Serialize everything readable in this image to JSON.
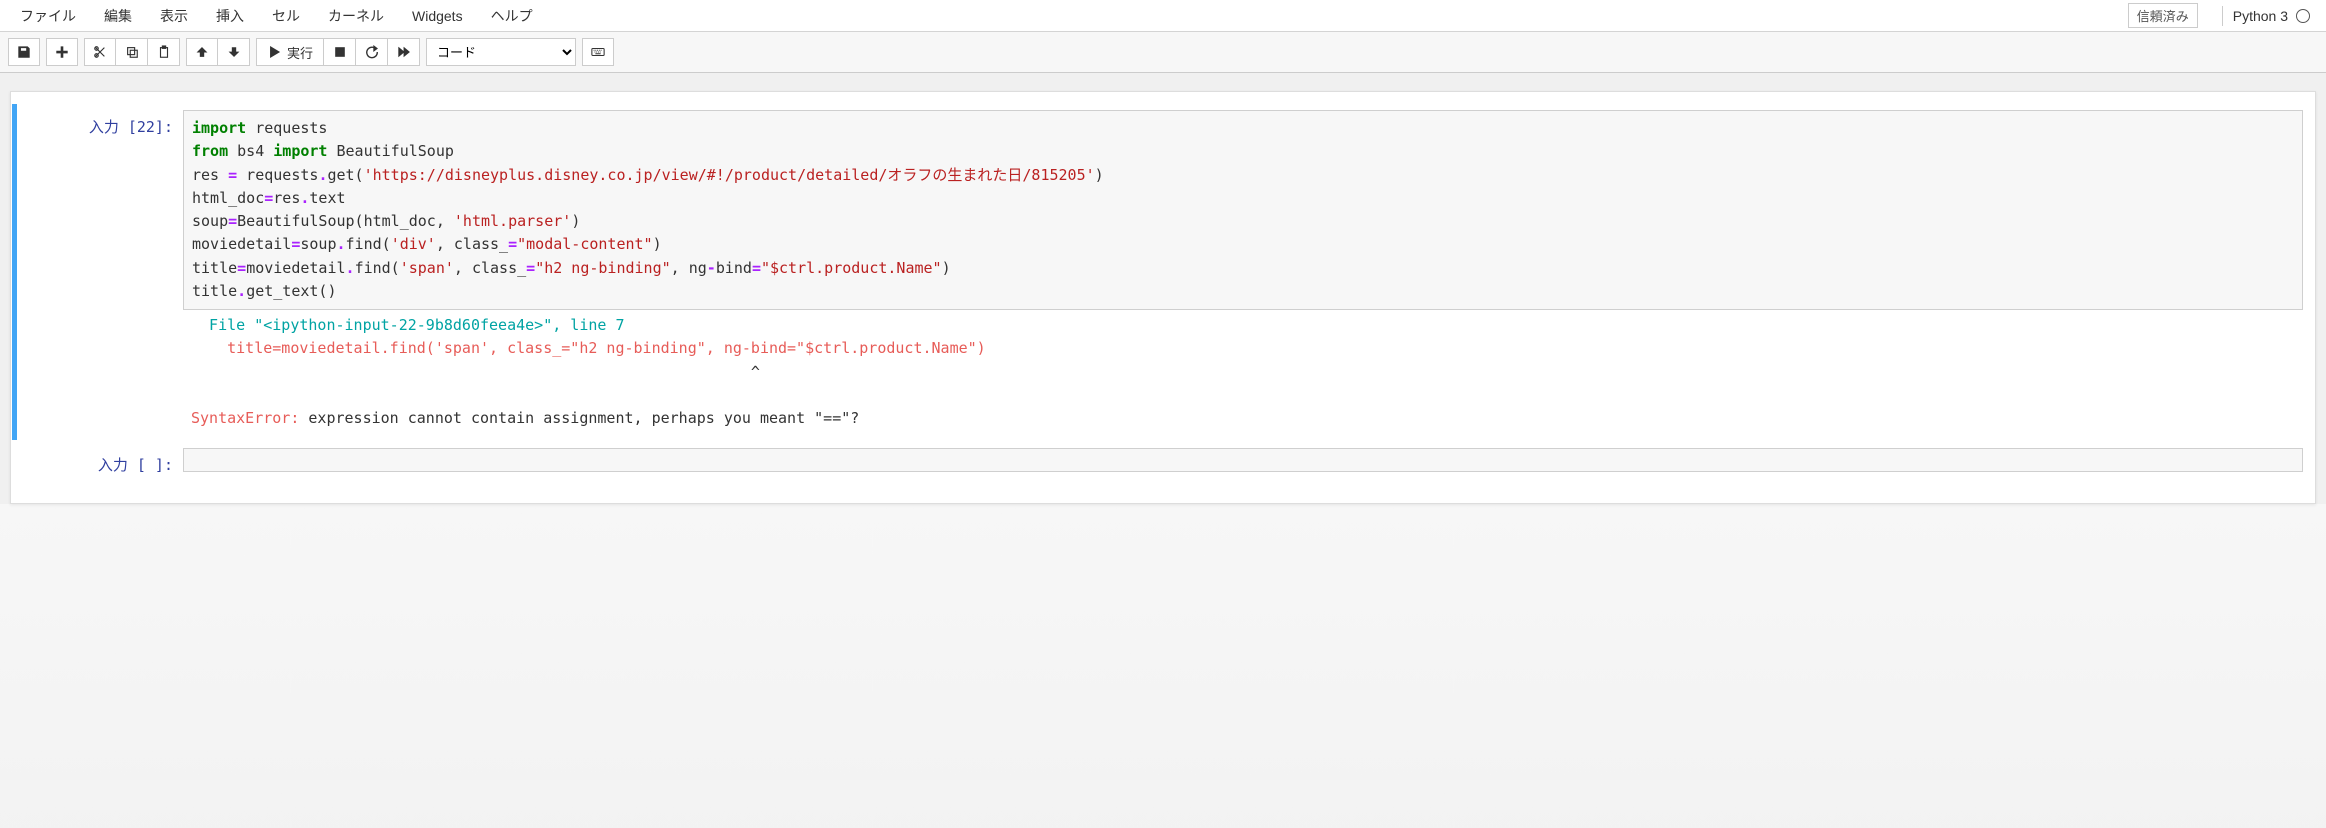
{
  "menubar": {
    "file": "ファイル",
    "edit": "編集",
    "view": "表示",
    "insert": "挿入",
    "cell": "セル",
    "kernel": "カーネル",
    "widgets": "Widgets",
    "help": "ヘルプ"
  },
  "header": {
    "trusted": "信頼済み",
    "kernel_name": "Python 3"
  },
  "toolbar": {
    "run_label": "実行",
    "celltype_selected": "コード"
  },
  "cells": {
    "c0": {
      "prompt_prefix": "入力 ",
      "prompt_num": "[22]:",
      "code": {
        "l1a": "import",
        "l1b": " requests",
        "l2a": "from",
        "l2b": " bs4 ",
        "l2c": "import",
        "l2d": " BeautifulSoup",
        "l3a": "res ",
        "l3b": "=",
        "l3c": " requests",
        "l3d": ".",
        "l3e": "get(",
        "l3f": "'https://disneyplus.disney.co.jp/view/#!/product/detailed/オラフの生まれた日/815205'",
        "l3g": ")",
        "l4a": "html_doc",
        "l4b": "=",
        "l4c": "res",
        "l4d": ".",
        "l4e": "text",
        "l5a": "soup",
        "l5b": "=",
        "l5c": "BeautifulSoup(html_doc, ",
        "l5d": "'html.parser'",
        "l5e": ")",
        "l6a": "moviedetail",
        "l6b": "=",
        "l6c": "soup",
        "l6d": ".",
        "l6e": "find(",
        "l6f": "'div'",
        "l6g": ", class_",
        "l6h": "=",
        "l6i": "\"modal-content\"",
        "l6j": ")",
        "l7a": "title",
        "l7b": "=",
        "l7c": "moviedetail",
        "l7d": ".",
        "l7e": "find(",
        "l7f": "'span'",
        "l7g": ", class_",
        "l7h": "=",
        "l7i": "\"h2 ng-binding\"",
        "l7j": ", ng",
        "l7k": "-",
        "l7l": "bind",
        "l7m": "=",
        "l7n": "\"$ctrl.product.Name\"",
        "l7o": ")",
        "l8a": "title",
        "l8b": ".",
        "l8c": "get_text()"
      },
      "traceback": {
        "l1a": "  File ",
        "l1b": "\"<ipython-input-22-9b8d60feea4e>\"",
        "l1c": ", line ",
        "l1d": "7",
        "l2": "    title=moviedetail.find('span', class_=\"h2 ng-binding\", ng-bind=\"$ctrl.product.Name\")",
        "l3": "                                                              ^",
        "l4a": "SyntaxError",
        "l4b": ": ",
        "l4c": "expression cannot contain assignment, perhaps you meant \"==\"?"
      }
    },
    "c1": {
      "prompt_prefix": "入力 ",
      "prompt_num": "[ ]:"
    }
  }
}
